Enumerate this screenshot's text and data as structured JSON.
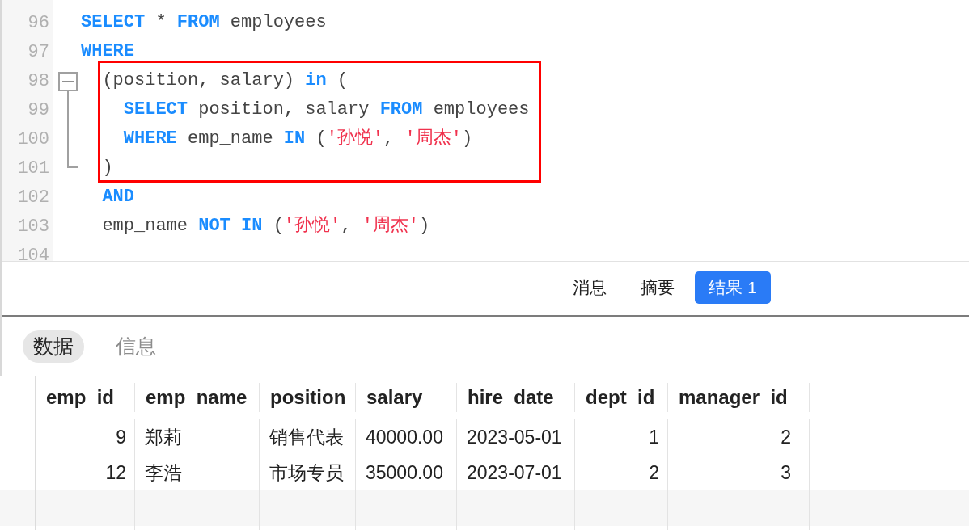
{
  "editor": {
    "lines": [
      {
        "number": "96",
        "kind": "code",
        "highlighted": false,
        "tokens": [
          {
            "text": "SELECT",
            "kind": "keyword"
          },
          {
            "text": " * ",
            "kind": "plain"
          },
          {
            "text": "FROM",
            "kind": "keyword"
          },
          {
            "text": " employees",
            "kind": "plain"
          }
        ]
      },
      {
        "number": "97",
        "kind": "code",
        "highlighted": false,
        "tokens": [
          {
            "text": "WHERE",
            "kind": "keyword"
          }
        ]
      },
      {
        "number": "98",
        "kind": "fold_start",
        "highlighted": true,
        "expanded": true,
        "tokens": [
          {
            "text": "  (position, salary) ",
            "kind": "plain"
          },
          {
            "text": "in",
            "kind": "keyword"
          },
          {
            "text": " (",
            "kind": "plain"
          }
        ]
      },
      {
        "number": "99",
        "kind": "code",
        "highlighted": true,
        "tokens": [
          {
            "text": "    SELECT",
            "kind": "keyword"
          },
          {
            "text": " position, salary ",
            "kind": "plain"
          },
          {
            "text": "FROM",
            "kind": "keyword"
          },
          {
            "text": " employees",
            "kind": "plain"
          }
        ]
      },
      {
        "number": "100",
        "kind": "code",
        "highlighted": true,
        "tokens": [
          {
            "text": "    WHERE",
            "kind": "keyword"
          },
          {
            "text": " emp_name ",
            "kind": "plain"
          },
          {
            "text": "IN",
            "kind": "keyword"
          },
          {
            "text": " (",
            "kind": "plain"
          },
          {
            "text": "'孙悦'",
            "kind": "string"
          },
          {
            "text": ", ",
            "kind": "plain"
          },
          {
            "text": "'周杰'",
            "kind": "string"
          },
          {
            "text": ")",
            "kind": "plain"
          }
        ]
      },
      {
        "number": "101",
        "kind": "fold_end",
        "highlighted": true,
        "tokens": [
          {
            "text": "  )",
            "kind": "plain"
          }
        ]
      },
      {
        "number": "102",
        "kind": "code",
        "highlighted": false,
        "tokens": [
          {
            "text": "  AND",
            "kind": "keyword"
          }
        ]
      },
      {
        "number": "103",
        "kind": "code",
        "highlighted": false,
        "tokens": [
          {
            "text": "  emp_name ",
            "kind": "plain"
          },
          {
            "text": "NOT IN",
            "kind": "keyword"
          },
          {
            "text": " (",
            "kind": "plain"
          },
          {
            "text": "'孙悦'",
            "kind": "string"
          },
          {
            "text": ", ",
            "kind": "plain"
          },
          {
            "text": "'周杰'",
            "kind": "string"
          },
          {
            "text": ")",
            "kind": "plain"
          }
        ]
      },
      {
        "number": "104",
        "kind": "code",
        "highlighted": false
      }
    ]
  },
  "result_tabs": [
    {
      "label": "消息",
      "selected": false
    },
    {
      "label": "摘要",
      "selected": false
    },
    {
      "label": "结果 1",
      "selected": true
    }
  ],
  "view_tabs": [
    {
      "label": "数据",
      "selected": true
    },
    {
      "label": "信息",
      "selected": false
    }
  ],
  "table": {
    "columns": [
      {
        "label": "emp_id",
        "kind": "numeric"
      },
      {
        "label": "emp_name",
        "kind": "text"
      },
      {
        "label": "position",
        "kind": "text"
      },
      {
        "label": "salary",
        "kind": "text"
      },
      {
        "label": "hire_date",
        "kind": "text"
      },
      {
        "label": "dept_id",
        "kind": "numeric"
      },
      {
        "label": "manager_id",
        "kind": "numeric"
      }
    ],
    "rows": [
      [
        "9",
        "郑莉",
        "销售代表",
        "40000.00",
        "2023-05-01",
        "1",
        "2"
      ],
      [
        "12",
        "李浩",
        "市场专员",
        "35000.00",
        "2023-07-01",
        "2",
        "3"
      ]
    ]
  }
}
